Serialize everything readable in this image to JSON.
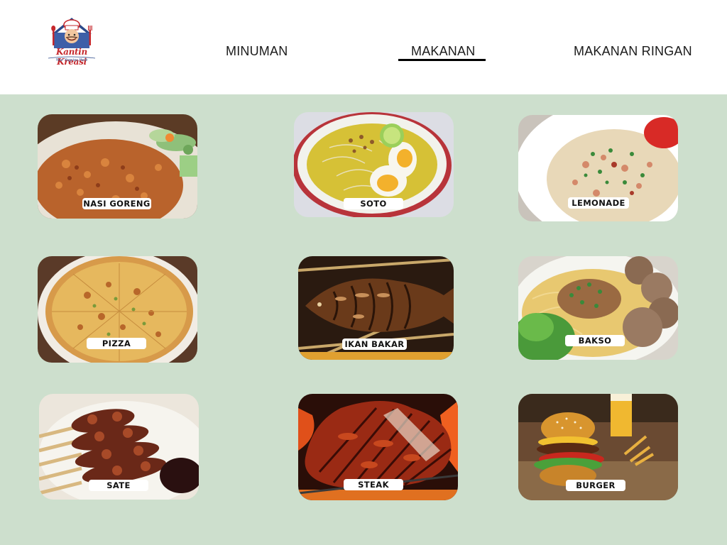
{
  "brand": {
    "name": "Kantin Kreasi",
    "tagline": "Your Yogyies Here"
  },
  "nav": {
    "items": [
      {
        "label": "MINUMAN",
        "active": false
      },
      {
        "label": "MAKANAN",
        "active": true
      },
      {
        "label": "MAKANAN RINGAN",
        "active": false
      }
    ]
  },
  "menu": {
    "items": [
      {
        "label": "NASI GORENG",
        "icon": "fried-rice-photo"
      },
      {
        "label": "SOTO",
        "icon": "soto-soup-photo"
      },
      {
        "label": "LEMONADE",
        "icon": "noodle-bowl-photo"
      },
      {
        "label": "PIZZA",
        "icon": "pizza-photo"
      },
      {
        "label": "IKAN BAKAR",
        "icon": "grilled-fish-photo"
      },
      {
        "label": "BAKSO",
        "icon": "meatball-noodle-photo"
      },
      {
        "label": "SATE",
        "icon": "satay-skewers-photo"
      },
      {
        "label": "STEAK",
        "icon": "grilled-steak-photo"
      },
      {
        "label": "BURGER",
        "icon": "burger-photo"
      }
    ]
  },
  "colors": {
    "background": "#cddfcd",
    "header": "#ffffff",
    "nav_active_underline": "#000000",
    "brand_red": "#c5282c",
    "brand_blue": "#2c4a8a"
  }
}
